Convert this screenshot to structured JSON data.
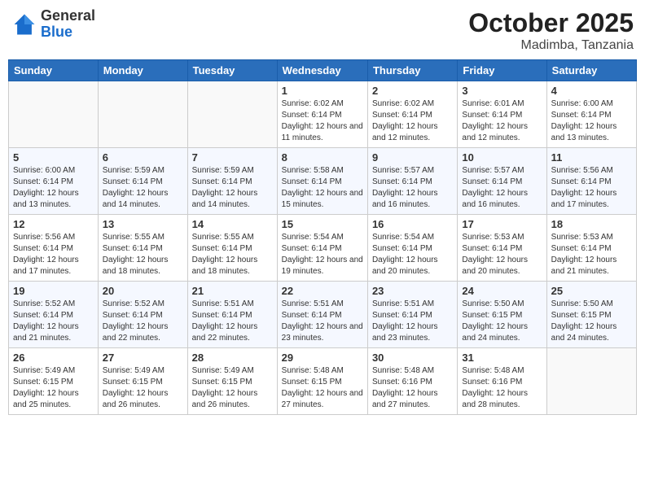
{
  "header": {
    "logo_general": "General",
    "logo_blue": "Blue",
    "month": "October 2025",
    "location": "Madimba, Tanzania"
  },
  "days_of_week": [
    "Sunday",
    "Monday",
    "Tuesday",
    "Wednesday",
    "Thursday",
    "Friday",
    "Saturday"
  ],
  "weeks": [
    [
      {
        "day": "",
        "info": ""
      },
      {
        "day": "",
        "info": ""
      },
      {
        "day": "",
        "info": ""
      },
      {
        "day": "1",
        "info": "Sunrise: 6:02 AM\nSunset: 6:14 PM\nDaylight: 12 hours\nand 11 minutes."
      },
      {
        "day": "2",
        "info": "Sunrise: 6:02 AM\nSunset: 6:14 PM\nDaylight: 12 hours\nand 12 minutes."
      },
      {
        "day": "3",
        "info": "Sunrise: 6:01 AM\nSunset: 6:14 PM\nDaylight: 12 hours\nand 12 minutes."
      },
      {
        "day": "4",
        "info": "Sunrise: 6:00 AM\nSunset: 6:14 PM\nDaylight: 12 hours\nand 13 minutes."
      }
    ],
    [
      {
        "day": "5",
        "info": "Sunrise: 6:00 AM\nSunset: 6:14 PM\nDaylight: 12 hours\nand 13 minutes."
      },
      {
        "day": "6",
        "info": "Sunrise: 5:59 AM\nSunset: 6:14 PM\nDaylight: 12 hours\nand 14 minutes."
      },
      {
        "day": "7",
        "info": "Sunrise: 5:59 AM\nSunset: 6:14 PM\nDaylight: 12 hours\nand 14 minutes."
      },
      {
        "day": "8",
        "info": "Sunrise: 5:58 AM\nSunset: 6:14 PM\nDaylight: 12 hours\nand 15 minutes."
      },
      {
        "day": "9",
        "info": "Sunrise: 5:57 AM\nSunset: 6:14 PM\nDaylight: 12 hours\nand 16 minutes."
      },
      {
        "day": "10",
        "info": "Sunrise: 5:57 AM\nSunset: 6:14 PM\nDaylight: 12 hours\nand 16 minutes."
      },
      {
        "day": "11",
        "info": "Sunrise: 5:56 AM\nSunset: 6:14 PM\nDaylight: 12 hours\nand 17 minutes."
      }
    ],
    [
      {
        "day": "12",
        "info": "Sunrise: 5:56 AM\nSunset: 6:14 PM\nDaylight: 12 hours\nand 17 minutes."
      },
      {
        "day": "13",
        "info": "Sunrise: 5:55 AM\nSunset: 6:14 PM\nDaylight: 12 hours\nand 18 minutes."
      },
      {
        "day": "14",
        "info": "Sunrise: 5:55 AM\nSunset: 6:14 PM\nDaylight: 12 hours\nand 18 minutes."
      },
      {
        "day": "15",
        "info": "Sunrise: 5:54 AM\nSunset: 6:14 PM\nDaylight: 12 hours\nand 19 minutes."
      },
      {
        "day": "16",
        "info": "Sunrise: 5:54 AM\nSunset: 6:14 PM\nDaylight: 12 hours\nand 20 minutes."
      },
      {
        "day": "17",
        "info": "Sunrise: 5:53 AM\nSunset: 6:14 PM\nDaylight: 12 hours\nand 20 minutes."
      },
      {
        "day": "18",
        "info": "Sunrise: 5:53 AM\nSunset: 6:14 PM\nDaylight: 12 hours\nand 21 minutes."
      }
    ],
    [
      {
        "day": "19",
        "info": "Sunrise: 5:52 AM\nSunset: 6:14 PM\nDaylight: 12 hours\nand 21 minutes."
      },
      {
        "day": "20",
        "info": "Sunrise: 5:52 AM\nSunset: 6:14 PM\nDaylight: 12 hours\nand 22 minutes."
      },
      {
        "day": "21",
        "info": "Sunrise: 5:51 AM\nSunset: 6:14 PM\nDaylight: 12 hours\nand 22 minutes."
      },
      {
        "day": "22",
        "info": "Sunrise: 5:51 AM\nSunset: 6:14 PM\nDaylight: 12 hours\nand 23 minutes."
      },
      {
        "day": "23",
        "info": "Sunrise: 5:51 AM\nSunset: 6:14 PM\nDaylight: 12 hours\nand 23 minutes."
      },
      {
        "day": "24",
        "info": "Sunrise: 5:50 AM\nSunset: 6:15 PM\nDaylight: 12 hours\nand 24 minutes."
      },
      {
        "day": "25",
        "info": "Sunrise: 5:50 AM\nSunset: 6:15 PM\nDaylight: 12 hours\nand 24 minutes."
      }
    ],
    [
      {
        "day": "26",
        "info": "Sunrise: 5:49 AM\nSunset: 6:15 PM\nDaylight: 12 hours\nand 25 minutes."
      },
      {
        "day": "27",
        "info": "Sunrise: 5:49 AM\nSunset: 6:15 PM\nDaylight: 12 hours\nand 26 minutes."
      },
      {
        "day": "28",
        "info": "Sunrise: 5:49 AM\nSunset: 6:15 PM\nDaylight: 12 hours\nand 26 minutes."
      },
      {
        "day": "29",
        "info": "Sunrise: 5:48 AM\nSunset: 6:15 PM\nDaylight: 12 hours\nand 27 minutes."
      },
      {
        "day": "30",
        "info": "Sunrise: 5:48 AM\nSunset: 6:16 PM\nDaylight: 12 hours\nand 27 minutes."
      },
      {
        "day": "31",
        "info": "Sunrise: 5:48 AM\nSunset: 6:16 PM\nDaylight: 12 hours\nand 28 minutes."
      },
      {
        "day": "",
        "info": ""
      }
    ]
  ]
}
